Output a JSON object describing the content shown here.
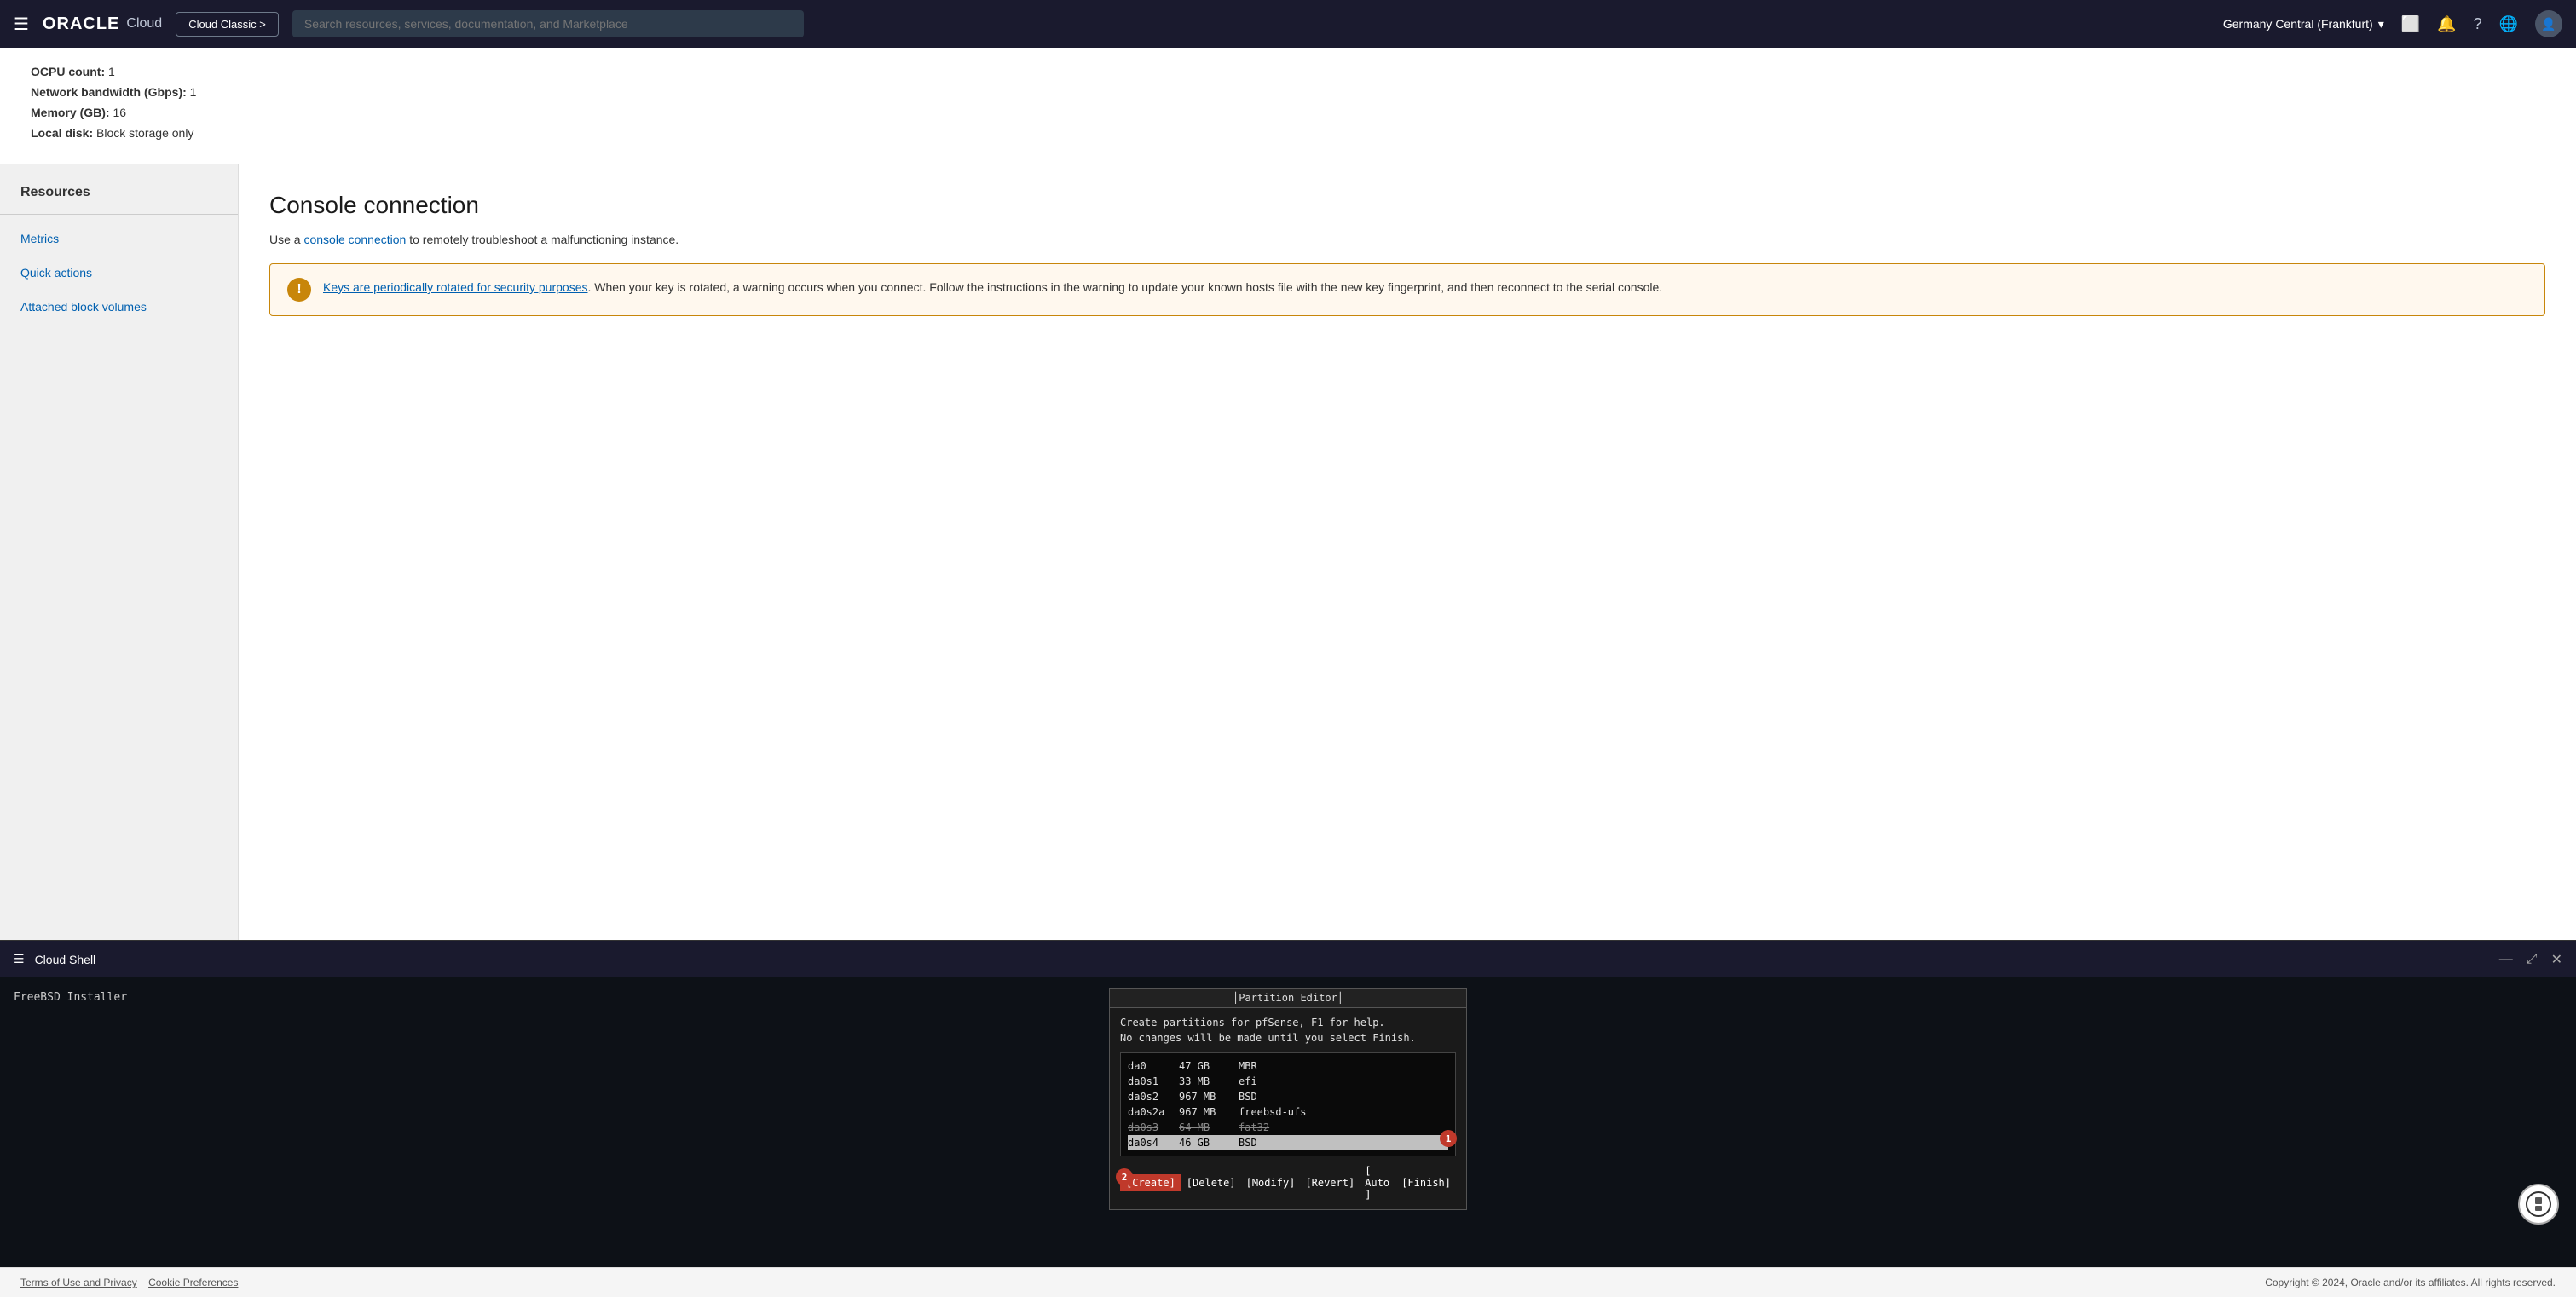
{
  "navbar": {
    "menu_label": "☰",
    "logo_oracle": "ORACLE",
    "logo_cloud": "Cloud",
    "cloud_classic_label": "Cloud Classic >",
    "search_placeholder": "Search resources, services, documentation, and Marketplace",
    "region": "Germany Central (Frankfurt)",
    "icons": {
      "screen": "⬜",
      "bell": "🔔",
      "question": "?",
      "globe": "🌐",
      "avatar": "👤"
    }
  },
  "info_panel": {
    "rows": [
      {
        "label": "OCPU count:",
        "value": "1"
      },
      {
        "label": "Network bandwidth (Gbps):",
        "value": "1"
      },
      {
        "label": "Memory (GB):",
        "value": "16"
      },
      {
        "label": "Local disk:",
        "value": "Block storage only"
      }
    ]
  },
  "sidebar": {
    "title": "Resources",
    "items": [
      {
        "label": "Metrics"
      },
      {
        "label": "Quick actions"
      },
      {
        "label": "Attached block volumes"
      }
    ]
  },
  "console_connection": {
    "title": "Console connection",
    "description_prefix": "Use a ",
    "link_text": "console connection",
    "description_suffix": " to remotely troubleshoot a malfunctioning instance.",
    "warning": {
      "icon": "!",
      "link_text": "Keys are periodically rotated for security purposes",
      "text": ". When your key is rotated, a warning occurs when you connect. Follow the instructions in the warning to update your known hosts file with the new key fingerprint, and then reconnect to the serial console."
    }
  },
  "cloud_shell": {
    "bar_title": "Cloud Shell",
    "icons": {
      "minimize": "—",
      "expand": "⤢",
      "close": "✕"
    },
    "terminal": {
      "freebsd_label": "FreeBSD Installer",
      "partition_editor": {
        "title": "Partition Editor",
        "desc_line1": "Create partitions for pfSense, F1 for help.",
        "desc_line2": "No changes will be made until you select Finish.",
        "partitions": [
          {
            "name": "da0",
            "size": "47 GB",
            "type": "MBR",
            "highlighted": false,
            "strikethrough": false
          },
          {
            "name": "  da0s1",
            "size": "33 MB",
            "type": "efi",
            "highlighted": false,
            "strikethrough": false
          },
          {
            "name": "  da0s2",
            "size": "967 MB",
            "type": "BSD",
            "highlighted": false,
            "strikethrough": false
          },
          {
            "name": "   da0s2a",
            "size": "967 MB",
            "type": "freebsd-ufs",
            "highlighted": false,
            "strikethrough": false
          },
          {
            "name": "  da0s3",
            "size": "64 MB",
            "type": "fat32",
            "highlighted": false,
            "strikethrough": true
          },
          {
            "name": "  da0s4",
            "size": "46 GB",
            "type": "BSD",
            "highlighted": true,
            "badge": "1",
            "strikethrough": false
          }
        ],
        "buttons": [
          {
            "label": "[Create]",
            "selected": true,
            "badge": "2"
          },
          {
            "label": "[Delete]",
            "selected": false
          },
          {
            "label": "[Modify]",
            "selected": false
          },
          {
            "label": "[Revert]",
            "selected": false
          },
          {
            "label": "[ Auto ]",
            "selected": false
          },
          {
            "label": "[Finish]",
            "selected": false
          }
        ]
      }
    }
  },
  "footer": {
    "left_links": [
      {
        "label": "Terms of Use and Privacy"
      },
      {
        "label": "Cookie Preferences"
      }
    ],
    "right_text": "Copyright © 2024, Oracle and/or its affiliates. All rights reserved."
  }
}
